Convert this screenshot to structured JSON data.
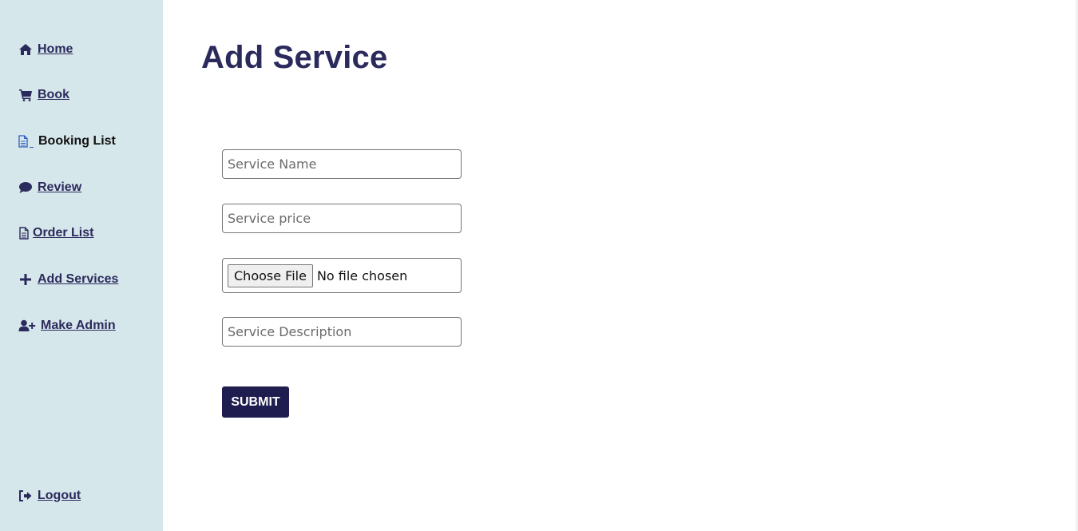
{
  "sidebar": {
    "items": [
      {
        "label": "Home",
        "icon": "home-icon"
      },
      {
        "label": "Book",
        "icon": "cart-icon"
      },
      {
        "label": "Booking List",
        "icon": "document-icon"
      },
      {
        "label": "Review",
        "icon": "comment-icon"
      },
      {
        "label": "Order List",
        "icon": "document-icon"
      },
      {
        "label": "Add Services",
        "icon": "plus-icon"
      },
      {
        "label": "Make Admin",
        "icon": "user-plus-icon"
      }
    ],
    "logout": {
      "label": "Logout",
      "icon": "logout-icon"
    }
  },
  "main": {
    "title": "Add Service",
    "form": {
      "service_name_placeholder": "Service Name",
      "service_price_placeholder": "Service price",
      "file_button_label": "Choose File",
      "file_status": "No file chosen",
      "service_description_placeholder": "Service Description",
      "submit_label": "SUBMIT"
    }
  },
  "colors": {
    "sidebar_bg": "#d6e7eb",
    "brand_navy": "#2b2a5c",
    "button_bg": "#1f1c4f"
  }
}
